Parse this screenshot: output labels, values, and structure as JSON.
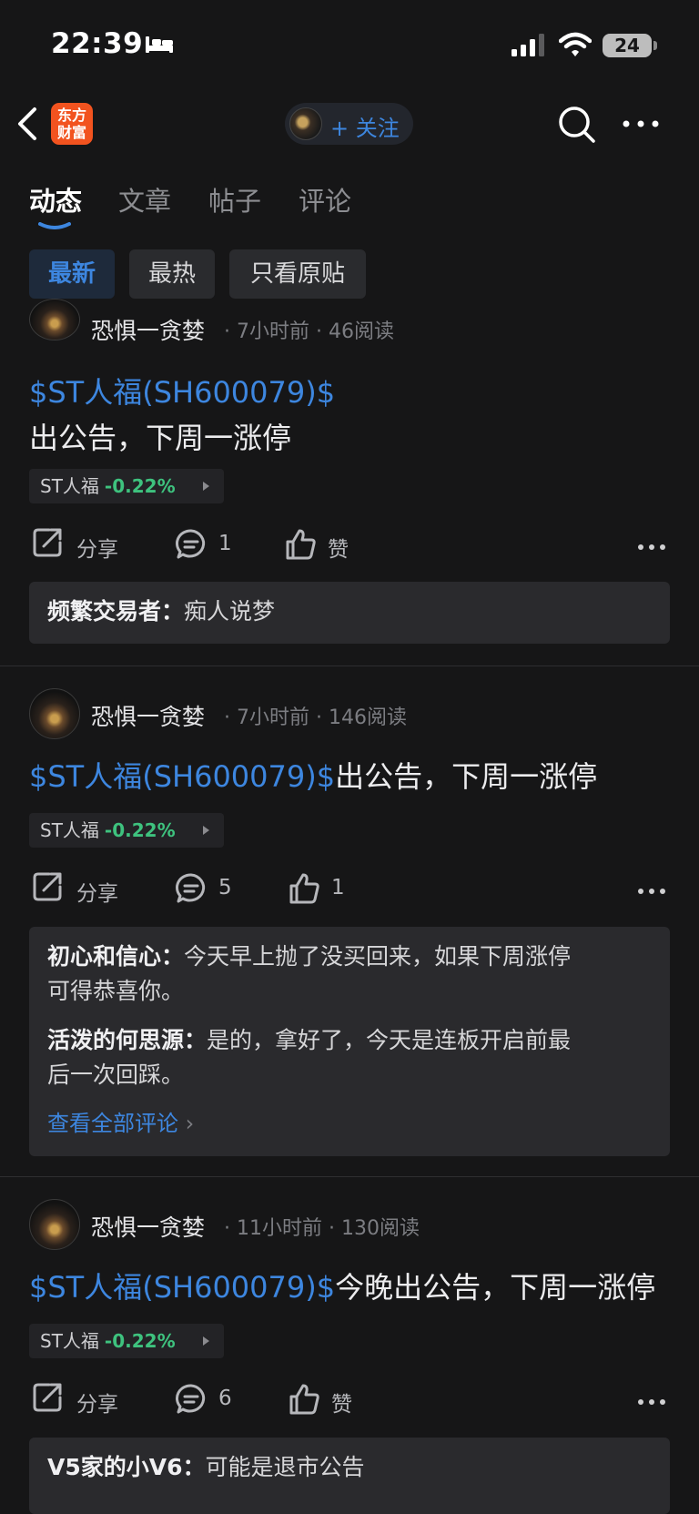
{
  "status_bar": {
    "time": "22:39",
    "battery": "24"
  },
  "nav": {
    "logo_text": "东方财富",
    "follow_label": "+ 关注"
  },
  "tabs": [
    {
      "label": "动态",
      "active": true
    },
    {
      "label": "文章",
      "active": false
    },
    {
      "label": "帖子",
      "active": false
    },
    {
      "label": "评论",
      "active": false
    }
  ],
  "filters": [
    {
      "label": "最新",
      "active": true
    },
    {
      "label": "最热",
      "active": false
    },
    {
      "label": "只看原贴",
      "active": false
    }
  ],
  "posts": [
    {
      "author": "恐惧一贪婪",
      "time": "7小时前",
      "reads": "46阅读",
      "cashtag": "$ST人福(SH600079)$",
      "text": "出公告，下周一涨停",
      "stock": {
        "name": "ST人福",
        "change": "-0.22%"
      },
      "share_label": "分享",
      "comment_count": "1",
      "like_label": "赞",
      "comments": [
        {
          "name": "频繁交易者：",
          "text": "痴人说梦"
        }
      ]
    },
    {
      "author": "恐惧一贪婪",
      "time": "7小时前",
      "reads": "146阅读",
      "cashtag": "$ST人福(SH600079)$",
      "text": "出公告，下周一涨停",
      "stock": {
        "name": "ST人福",
        "change": "-0.22%"
      },
      "share_label": "分享",
      "comment_count": "5",
      "like_label": "1",
      "comments": [
        {
          "name": "初心和信心：",
          "text": "今天早上抛了没买回来，如果下周涨停",
          "text2": "可得恭喜你。"
        },
        {
          "name": "活泼的何思源：",
          "text": "是的，拿好了，今天是连板开启前最",
          "text2": "后一次回踩。"
        }
      ],
      "view_all": "查看全部评论"
    },
    {
      "author": "恐惧一贪婪",
      "time": "11小时前",
      "reads": "130阅读",
      "cashtag": "$ST人福(SH600079)$",
      "text": "今晚出公告，下周一涨停",
      "stock": {
        "name": "ST人福",
        "change": "-0.22%"
      },
      "share_label": "分享",
      "comment_count": "6",
      "like_label": "赞",
      "comments": [
        {
          "name": "V5家的小V6：",
          "text": "可能是退市公告"
        }
      ]
    }
  ]
}
